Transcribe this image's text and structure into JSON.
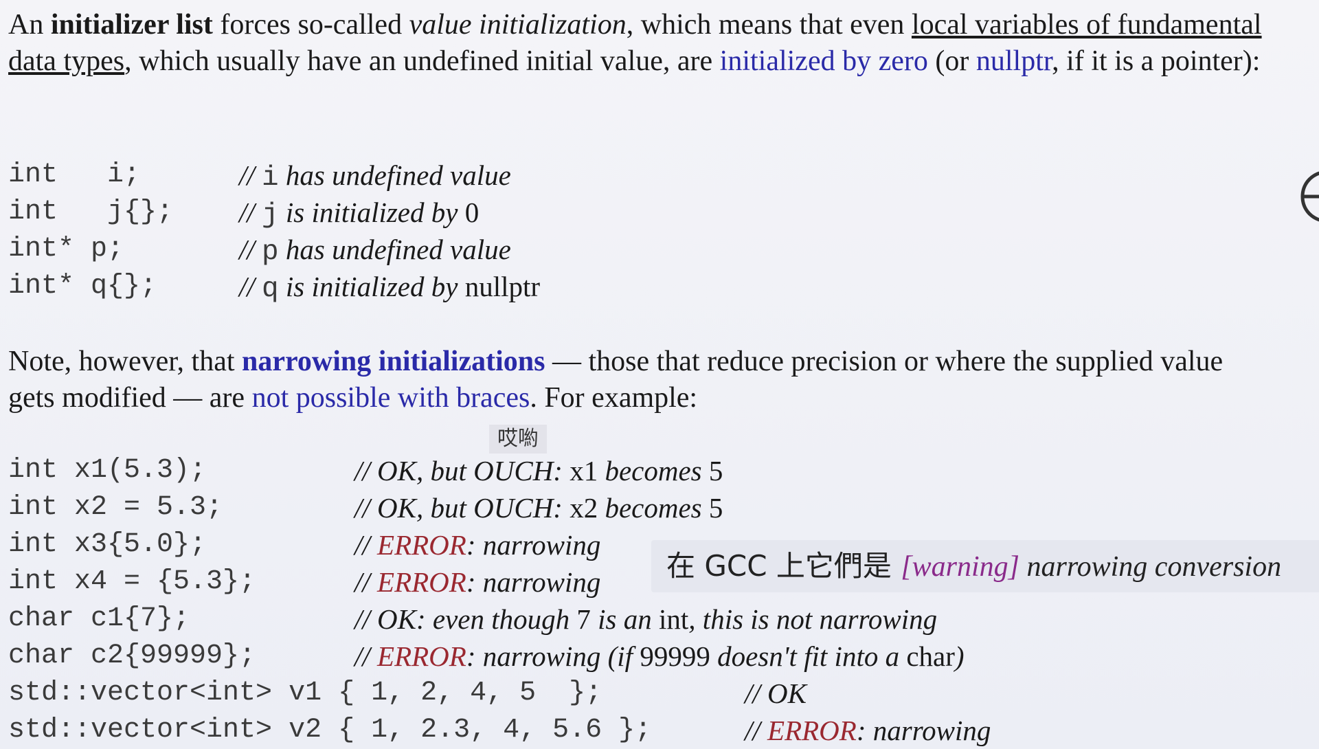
{
  "intro": {
    "t1": "An ",
    "t2": "initializer list",
    "t3": " forces so-called ",
    "t4": "value initialization",
    "t5": ", which means that even ",
    "t6": "local variables of fundamental data types",
    "t7": ", which usually have an undefined initial value, are ",
    "t8": "initialized by zero",
    "t9": " (or ",
    "t10": "nullptr",
    "t11": ", if it is a pointer):"
  },
  "block1": [
    {
      "code": "int   i;",
      "c1": "// ",
      "cv": "i",
      "c2": " has undefined value",
      "c3": ""
    },
    {
      "code": "int   j{};",
      "c1": "// ",
      "cv": "j",
      "c2": " is initialized by ",
      "c3": "0"
    },
    {
      "code": "int* p;",
      "c1": "// ",
      "cv": "p",
      "c2": " has undefined value",
      "c3": ""
    },
    {
      "code": "int* q{};",
      "c1": "// ",
      "cv": "q",
      "c2": " is initialized by ",
      "c3": "nullptr"
    }
  ],
  "note": {
    "t1": "Note, however, that ",
    "t2": "narrowing initializations",
    "t3": " — those that reduce precision or where the supplied value gets modified — are ",
    "t4": "not possible with braces",
    "t5": ". For example:"
  },
  "subtitle_small": "哎喲",
  "block2": [
    {
      "code": "int x1(5.3);",
      "c1": "// OK, but OUCH: ",
      "cv": "x1",
      "c2": " becomes ",
      "c3": "5"
    },
    {
      "code": "int x2 = 5.3;",
      "c1": "// OK, but OUCH: ",
      "cv": "x2",
      "c2": " becomes ",
      "c3": "5"
    },
    {
      "code": "int x3{5.0};",
      "c1": "// ",
      "err": "ERROR",
      "c2": ": narrowing"
    },
    {
      "code": "int x4 = {5.3};",
      "c1": "// ",
      "err": "ERROR",
      "c2": ": narrowing"
    },
    {
      "code": "char c1{7};",
      "c1": "// OK: even though ",
      "cv": "7",
      "c2": " is an ",
      "c3": "int",
      "c4": ", this is not narrowing"
    },
    {
      "code": "char c2{99999};",
      "c1": "// ",
      "err": "ERROR",
      "c2": ": narrowing (if ",
      "cv": "99999",
      "c3": " doesn't fit into a ",
      "c4": "char",
      "c5": ")"
    },
    {
      "code": "std::vector<int> v1 { 1, 2, 4, 5  };",
      "c1": "// OK"
    },
    {
      "code": "std::vector<int> v2 { 1, 2.3, 4, 5.6 };",
      "c1": "// ",
      "err": "ERROR",
      "c2": ": narrowing"
    }
  ],
  "subtitle_big": {
    "cjk1": "在 GCC 上它們是 ",
    "warn": "[warning]",
    "rest": " narrowing conversion"
  },
  "colors": {
    "link_blue": "#2a2aa8",
    "error_red": "#9a2830",
    "warning_purple": "#8a2a8a"
  },
  "edge_icon": "partial-circle-icon"
}
